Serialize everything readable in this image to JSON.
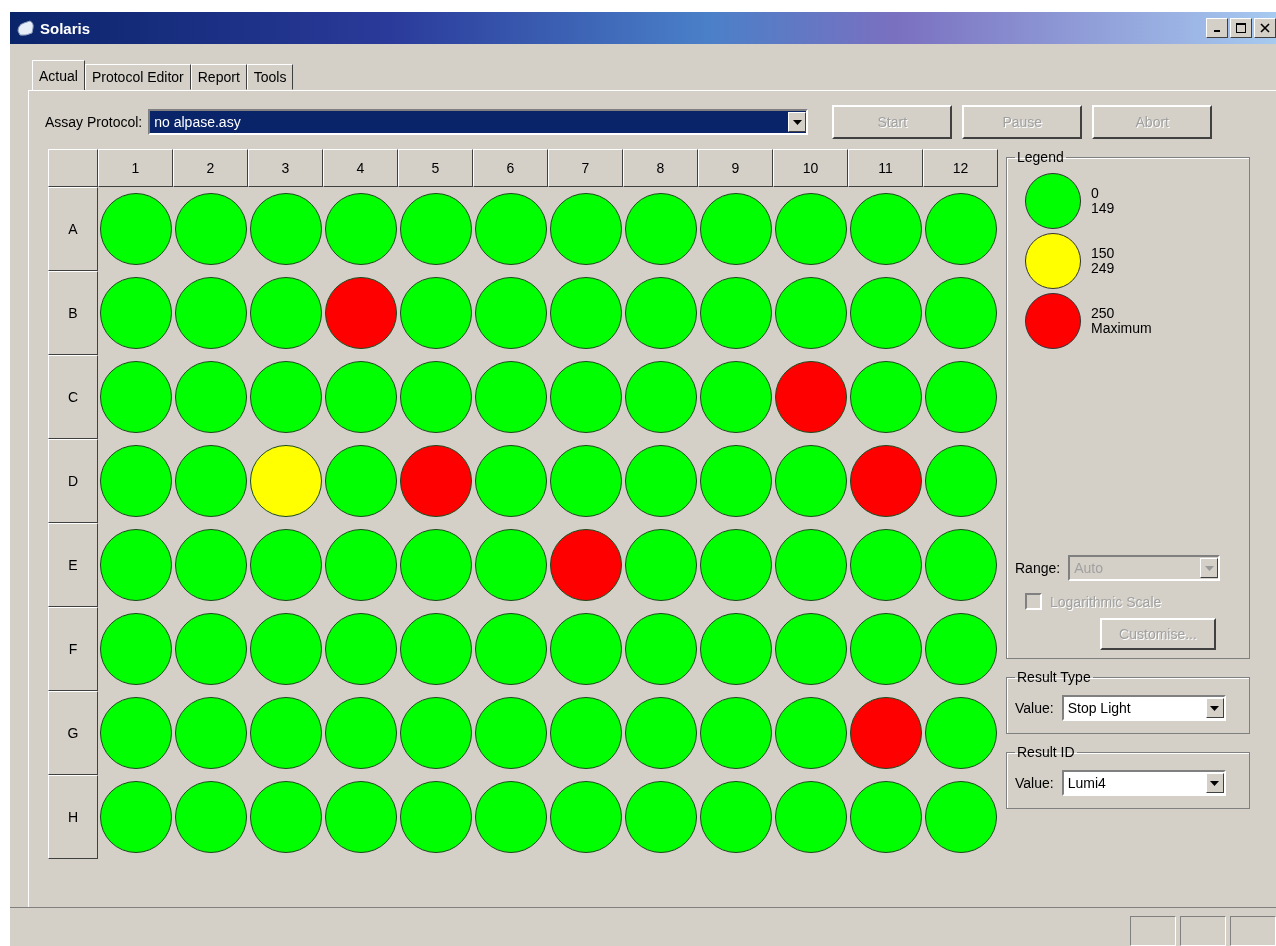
{
  "window": {
    "title": "Solaris"
  },
  "tabs": [
    {
      "label": "Actual",
      "selected": true
    },
    {
      "label": "Protocol Editor",
      "selected": false
    },
    {
      "label": "Report",
      "selected": false
    },
    {
      "label": "Tools",
      "selected": false
    }
  ],
  "assay_protocol": {
    "label": "Assay Protocol:",
    "value": "no alpase.asy"
  },
  "buttons": [
    {
      "label": "Start",
      "disabled": true
    },
    {
      "label": "Pause",
      "disabled": true
    },
    {
      "label": "Abort",
      "disabled": true
    }
  ],
  "plate": {
    "columns": [
      "1",
      "2",
      "3",
      "4",
      "5",
      "6",
      "7",
      "8",
      "9",
      "10",
      "11",
      "12"
    ],
    "rows": [
      {
        "label": "A",
        "wells": [
          {
            "color": "#00ff00"
          },
          {
            "color": "#00ff00"
          },
          {
            "color": "#00ff00"
          },
          {
            "color": "#00ff00"
          },
          {
            "color": "#00ff00"
          },
          {
            "color": "#00ff00"
          },
          {
            "color": "#00ff00"
          },
          {
            "color": "#00ff00"
          },
          {
            "color": "#00ff00"
          },
          {
            "color": "#00ff00"
          },
          {
            "color": "#00ff00"
          },
          {
            "color": "#00ff00"
          }
        ]
      },
      {
        "label": "B",
        "wells": [
          {
            "color": "#00ff00"
          },
          {
            "color": "#00ff00"
          },
          {
            "color": "#00ff00"
          },
          {
            "color": "#ff0000"
          },
          {
            "color": "#00ff00"
          },
          {
            "color": "#00ff00"
          },
          {
            "color": "#00ff00"
          },
          {
            "color": "#00ff00"
          },
          {
            "color": "#00ff00"
          },
          {
            "color": "#00ff00"
          },
          {
            "color": "#00ff00"
          },
          {
            "color": "#00ff00"
          }
        ]
      },
      {
        "label": "C",
        "wells": [
          {
            "color": "#00ff00"
          },
          {
            "color": "#00ff00"
          },
          {
            "color": "#00ff00"
          },
          {
            "color": "#00ff00"
          },
          {
            "color": "#00ff00"
          },
          {
            "color": "#00ff00"
          },
          {
            "color": "#00ff00"
          },
          {
            "color": "#00ff00"
          },
          {
            "color": "#00ff00"
          },
          {
            "color": "#ff0000"
          },
          {
            "color": "#00ff00"
          },
          {
            "color": "#00ff00"
          }
        ]
      },
      {
        "label": "D",
        "wells": [
          {
            "color": "#00ff00"
          },
          {
            "color": "#00ff00"
          },
          {
            "color": "#ffff00"
          },
          {
            "color": "#00ff00"
          },
          {
            "color": "#ff0000"
          },
          {
            "color": "#00ff00"
          },
          {
            "color": "#00ff00"
          },
          {
            "color": "#00ff00"
          },
          {
            "color": "#00ff00"
          },
          {
            "color": "#00ff00"
          },
          {
            "color": "#ff0000"
          },
          {
            "color": "#00ff00"
          }
        ]
      },
      {
        "label": "E",
        "wells": [
          {
            "color": "#00ff00"
          },
          {
            "color": "#00ff00"
          },
          {
            "color": "#00ff00"
          },
          {
            "color": "#00ff00"
          },
          {
            "color": "#00ff00"
          },
          {
            "color": "#00ff00"
          },
          {
            "color": "#ff0000"
          },
          {
            "color": "#00ff00"
          },
          {
            "color": "#00ff00"
          },
          {
            "color": "#00ff00"
          },
          {
            "color": "#00ff00"
          },
          {
            "color": "#00ff00"
          }
        ]
      },
      {
        "label": "F",
        "wells": [
          {
            "color": "#00ff00"
          },
          {
            "color": "#00ff00"
          },
          {
            "color": "#00ff00"
          },
          {
            "color": "#00ff00"
          },
          {
            "color": "#00ff00"
          },
          {
            "color": "#00ff00"
          },
          {
            "color": "#00ff00"
          },
          {
            "color": "#00ff00"
          },
          {
            "color": "#00ff00"
          },
          {
            "color": "#00ff00"
          },
          {
            "color": "#00ff00"
          },
          {
            "color": "#00ff00"
          }
        ]
      },
      {
        "label": "G",
        "wells": [
          {
            "color": "#00ff00"
          },
          {
            "color": "#00ff00"
          },
          {
            "color": "#00ff00"
          },
          {
            "color": "#00ff00"
          },
          {
            "color": "#00ff00"
          },
          {
            "color": "#00ff00"
          },
          {
            "color": "#00ff00"
          },
          {
            "color": "#00ff00"
          },
          {
            "color": "#00ff00"
          },
          {
            "color": "#00ff00"
          },
          {
            "color": "#ff0000"
          },
          {
            "color": "#00ff00"
          }
        ]
      },
      {
        "label": "H",
        "wells": [
          {
            "color": "#00ff00"
          },
          {
            "color": "#00ff00"
          },
          {
            "color": "#00ff00"
          },
          {
            "color": "#00ff00"
          },
          {
            "color": "#00ff00"
          },
          {
            "color": "#00ff00"
          },
          {
            "color": "#00ff00"
          },
          {
            "color": "#00ff00"
          },
          {
            "color": "#00ff00"
          },
          {
            "color": "#00ff00"
          },
          {
            "color": "#00ff00"
          },
          {
            "color": "#00ff00"
          }
        ]
      }
    ]
  },
  "legend": {
    "title": "Legend",
    "items": [
      {
        "color": "#00ff00",
        "from": "0",
        "to": "149"
      },
      {
        "color": "#ffff00",
        "from": "150",
        "to": "249"
      },
      {
        "color": "#ff0000",
        "from": "250",
        "to": "Maximum"
      }
    ],
    "range": {
      "label": "Range:",
      "value": "Auto",
      "disabled": true
    },
    "log_scale": {
      "label": "Logarithmic Scale",
      "checked": false,
      "disabled": true
    },
    "customise": {
      "label": "Customise...",
      "disabled": true
    }
  },
  "result_type": {
    "title": "Result Type",
    "label": "Value:",
    "value": "Stop Light"
  },
  "result_id": {
    "title": "Result ID",
    "label": "Value:",
    "value": "Lumi4"
  }
}
